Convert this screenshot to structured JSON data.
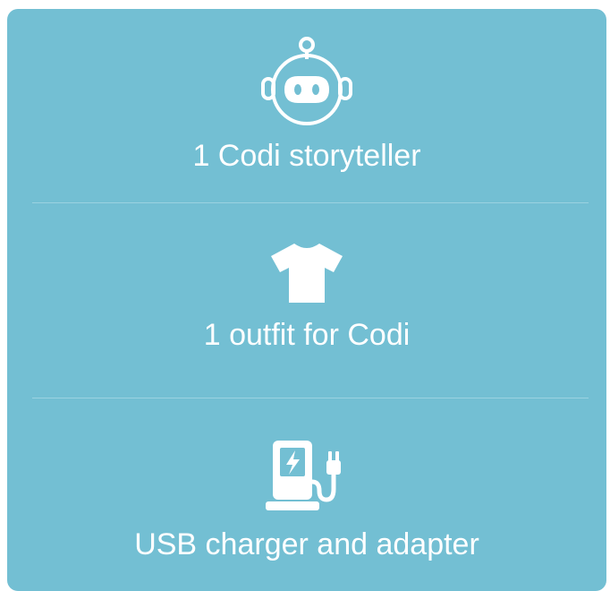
{
  "card": {
    "background": "#73bfd3",
    "text_color": "#ffffff"
  },
  "items": [
    {
      "icon": "robot-icon",
      "label": "1 Codi storyteller"
    },
    {
      "icon": "tshirt-icon",
      "label": "1 outfit for Codi"
    },
    {
      "icon": "charging-station-icon",
      "label": "USB charger and adapter"
    }
  ]
}
